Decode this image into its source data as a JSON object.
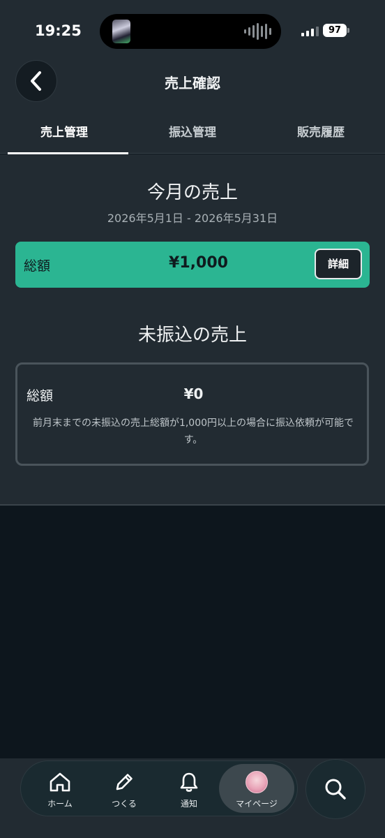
{
  "status_bar": {
    "time": "19:25",
    "battery": "97"
  },
  "header": {
    "title": "売上確認"
  },
  "tabs": [
    {
      "label": "売上管理",
      "active": true
    },
    {
      "label": "振込管理",
      "active": false
    },
    {
      "label": "販売履歴",
      "active": false
    }
  ],
  "monthly": {
    "title": "今月の売上",
    "period": "2026年5月1日 - 2026年5月31日",
    "total_label": "総額",
    "total_amount": "¥1,000",
    "detail_button": "詳細"
  },
  "unpaid": {
    "title": "未振込の売上",
    "total_label": "総額",
    "total_amount": "¥0",
    "note": "前月末までの未振込の売上総額が1,000円以上の場合に振込依頼が可能です。"
  },
  "bottom_nav": {
    "items": [
      {
        "label": "ホーム",
        "icon": "home-icon"
      },
      {
        "label": "つくる",
        "icon": "pencil-icon"
      },
      {
        "label": "通知",
        "icon": "bell-icon"
      },
      {
        "label": "マイページ",
        "icon": "avatar"
      }
    ],
    "active": "マイページ",
    "search_icon": "search-icon"
  },
  "colors": {
    "accent": "#2bb592",
    "background": "#222b32",
    "bottom_bg": "#0d161d"
  }
}
